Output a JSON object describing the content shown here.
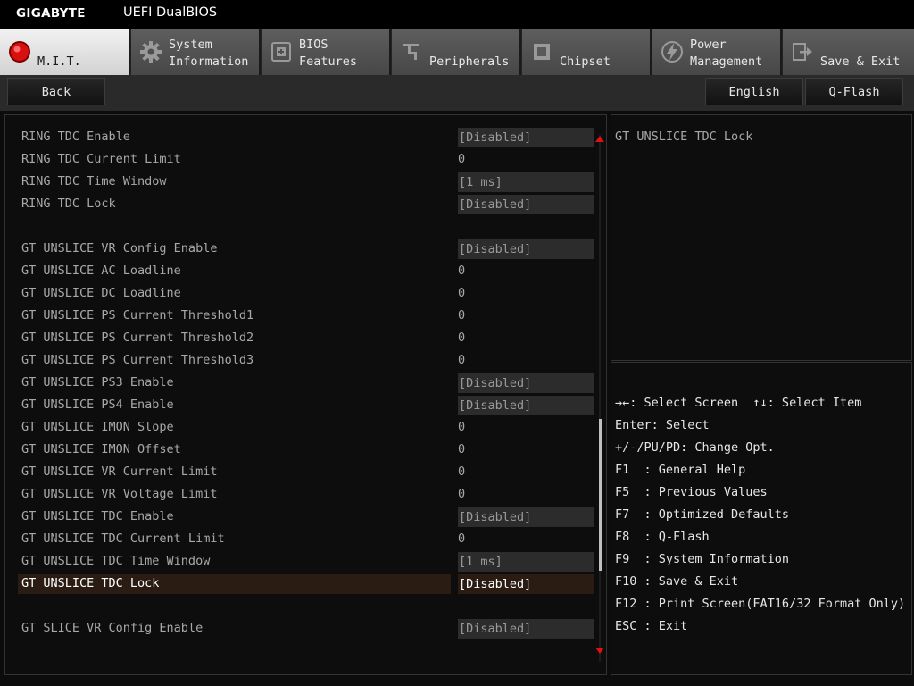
{
  "brand": "GIGABYTE",
  "title": "UEFI DualBIOS",
  "tabs": [
    {
      "line1": "M.I.T.",
      "line2": "",
      "icon": "mit-icon"
    },
    {
      "line1": "System",
      "line2": "Information",
      "icon": "gear-icon"
    },
    {
      "line1": "BIOS",
      "line2": "Features",
      "icon": "chip-icon"
    },
    {
      "line1": "Peripherals",
      "line2": "",
      "icon": "plug-icon"
    },
    {
      "line1": "Chipset",
      "line2": "",
      "icon": "chipset-icon"
    },
    {
      "line1": "Power",
      "line2": "Management",
      "icon": "power-icon"
    },
    {
      "line1": "Save & Exit",
      "line2": "",
      "icon": "exit-icon"
    }
  ],
  "buttons": {
    "back": "Back",
    "language": "English",
    "qflash": "Q-Flash"
  },
  "settings": [
    {
      "label": "RING TDC Enable",
      "value": "[Disabled]",
      "boxed": true
    },
    {
      "label": "RING TDC Current Limit",
      "value": "0",
      "boxed": false
    },
    {
      "label": "RING TDC Time Window",
      "value": "[1 ms]",
      "boxed": true
    },
    {
      "label": "RING TDC Lock",
      "value": "[Disabled]",
      "boxed": true
    },
    {
      "label": "GT UNSLICE VR Config Enable",
      "value": "[Disabled]",
      "boxed": true
    },
    {
      "label": "GT UNSLICE AC Loadline",
      "value": "0",
      "boxed": false
    },
    {
      "label": "GT UNSLICE DC Loadline",
      "value": "0",
      "boxed": false
    },
    {
      "label": "GT UNSLICE PS Current Threshold1",
      "value": "0",
      "boxed": false
    },
    {
      "label": "GT UNSLICE PS Current Threshold2",
      "value": "0",
      "boxed": false
    },
    {
      "label": "GT UNSLICE PS Current Threshold3",
      "value": "0",
      "boxed": false
    },
    {
      "label": "GT UNSLICE PS3 Enable",
      "value": "[Disabled]",
      "boxed": true
    },
    {
      "label": "GT UNSLICE PS4 Enable",
      "value": "[Disabled]",
      "boxed": true
    },
    {
      "label": "GT UNSLICE IMON Slope",
      "value": "0",
      "boxed": false
    },
    {
      "label": "GT UNSLICE IMON Offset",
      "value": "0",
      "boxed": false
    },
    {
      "label": "GT UNSLICE VR Current Limit",
      "value": "0",
      "boxed": false
    },
    {
      "label": "GT UNSLICE VR Voltage Limit",
      "value": "0",
      "boxed": false
    },
    {
      "label": "GT UNSLICE TDC Enable",
      "value": "[Disabled]",
      "boxed": true
    },
    {
      "label": "GT UNSLICE TDC Current Limit",
      "value": "0",
      "boxed": false
    },
    {
      "label": "GT UNSLICE TDC Time Window",
      "value": "[1 ms]",
      "boxed": true
    },
    {
      "label": "GT UNSLICE TDC Lock",
      "value": "[Disabled]",
      "boxed": true,
      "selected": true
    },
    {
      "label": "GT SLICE VR Config Enable",
      "value": "[Disabled]",
      "boxed": true
    }
  ],
  "help": {
    "description": "GT UNSLICE TDC Lock",
    "lines": [
      "→←: Select Screen  ↑↓: Select Item",
      "Enter: Select",
      "+/-/PU/PD: Change Opt.",
      "F1  : General Help",
      "F5  : Previous Values",
      "F7  : Optimized Defaults",
      "F8  : Q-Flash",
      "F9  : System Information",
      "F10 : Save & Exit",
      "F12 : Print Screen(FAT16/32 Format Only)",
      "ESC : Exit"
    ]
  },
  "colors": {
    "accent": "#e01010",
    "selected_row": "#2a1c12"
  }
}
